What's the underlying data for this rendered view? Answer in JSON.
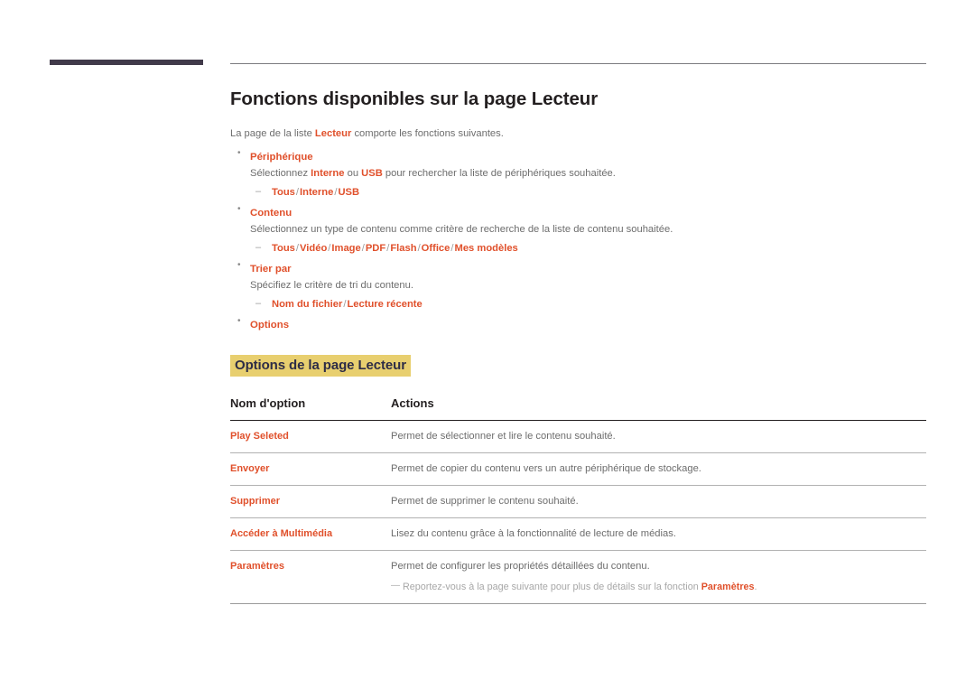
{
  "page": {
    "title": "Fonctions disponibles sur la page Lecteur",
    "intro_before": "La page de la liste ",
    "intro_emphasis": "Lecteur",
    "intro_after": " comporte les fonctions suivantes."
  },
  "bullets": [
    {
      "head": "Périphérique",
      "desc_before": "Sélectionnez ",
      "desc_em1": "Interne",
      "desc_mid": " ou ",
      "desc_em2": "USB",
      "desc_after": " pour rechercher la liste de périphériques souhaitée.",
      "options": [
        "Tous",
        "Interne",
        "USB"
      ]
    },
    {
      "head": "Contenu",
      "desc": "Sélectionnez un type de contenu comme critère de recherche de la liste de contenu souhaitée.",
      "options": [
        "Tous",
        "Vidéo",
        "Image",
        "PDF",
        "Flash",
        "Office",
        "Mes modèles"
      ]
    },
    {
      "head": "Trier par",
      "desc": "Spécifiez le critère de tri du contenu.",
      "options": [
        "Nom du fichier",
        "Lecture récente"
      ]
    },
    {
      "head": "Options"
    }
  ],
  "section": {
    "heading": "Options de la page Lecteur"
  },
  "table": {
    "headers": [
      "Nom d'option",
      "Actions"
    ],
    "rows": [
      {
        "name": "Play Seleted",
        "action": "Permet de sélectionner et lire le contenu souhaité."
      },
      {
        "name": "Envoyer",
        "action": "Permet de copier du contenu vers un autre périphérique de stockage."
      },
      {
        "name": "Supprimer",
        "action": "Permet de supprimer le contenu souhaité."
      },
      {
        "name": "Accéder à Multimédia",
        "action": "Lisez du contenu grâce à la fonctionnalité de lecture de médias."
      },
      {
        "name": "Paramètres",
        "action": "Permet de configurer les propriétés détaillées du contenu.",
        "note_before": "Reportez-vous à la page suivante pour plus de détails sur la fonction ",
        "note_emphasis": "Paramètres",
        "note_after": "."
      }
    ]
  },
  "colors": {
    "accent_orange": "#e0502b",
    "highlight_gold": "#e8cf6f",
    "heading_navy": "#2d2c46",
    "rule_dark": "#413a4a",
    "body_gray": "#6d6d6d"
  }
}
